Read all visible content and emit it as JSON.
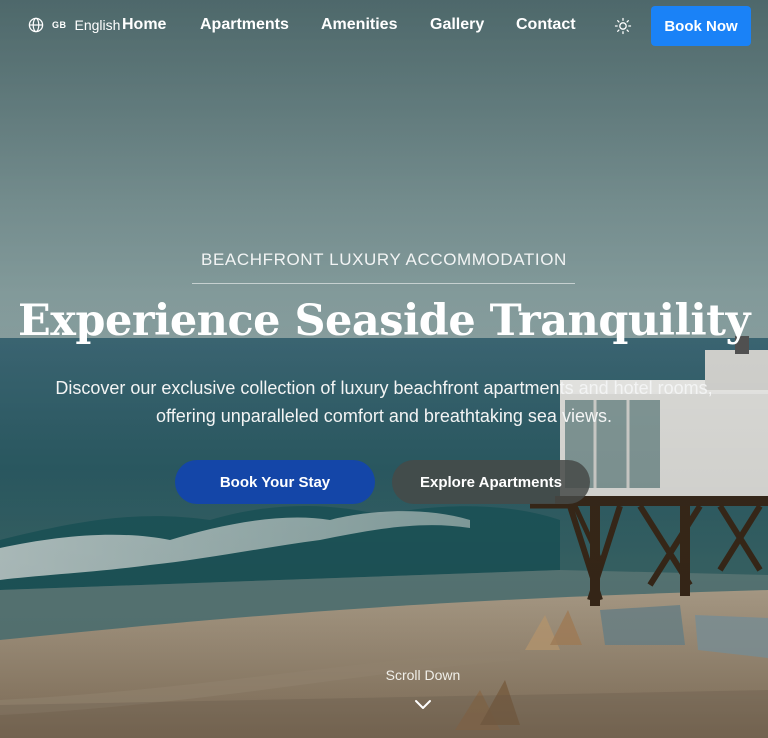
{
  "nav": {
    "language": {
      "flag_code": "GB",
      "label": "English",
      "icon": "globe-icon"
    },
    "links": [
      "Home",
      "Apartments",
      "Amenities",
      "Gallery",
      "Contact"
    ],
    "theme_toggle_icon": "sun-icon",
    "cta_label": "Book Now"
  },
  "hero": {
    "eyebrow": "BEACHFRONT LUXURY ACCOMMODATION",
    "title": "Experience Seaside Tranquility",
    "subtitle": "Discover our exclusive collection of luxury beachfront apartments and hotel rooms, offering unparalleled comfort and breathtaking sea views.",
    "primary_button": "Book Your Stay",
    "secondary_button": "Explore Apartments",
    "scroll_label": "Scroll Down",
    "scroll_icon": "chevron-down-icon"
  },
  "colors": {
    "primary_cta": "#1446a8",
    "nav_cta": "#1a82f7",
    "secondary_cta": "#464a48"
  }
}
